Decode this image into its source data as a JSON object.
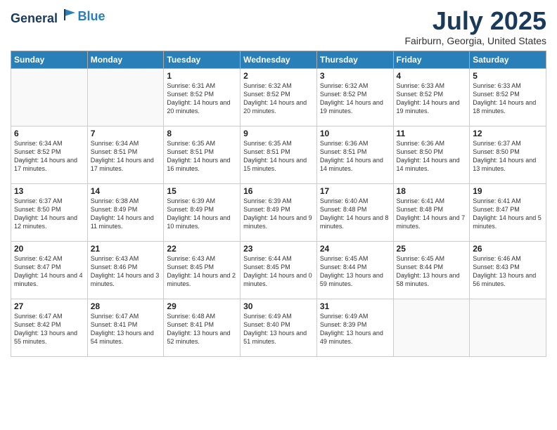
{
  "logo": {
    "general": "General",
    "blue": "Blue"
  },
  "title": "July 2025",
  "location": "Fairburn, Georgia, United States",
  "weekdays": [
    "Sunday",
    "Monday",
    "Tuesday",
    "Wednesday",
    "Thursday",
    "Friday",
    "Saturday"
  ],
  "weeks": [
    [
      {
        "day": "",
        "info": ""
      },
      {
        "day": "",
        "info": ""
      },
      {
        "day": "1",
        "info": "Sunrise: 6:31 AM\nSunset: 8:52 PM\nDaylight: 14 hours and 20 minutes."
      },
      {
        "day": "2",
        "info": "Sunrise: 6:32 AM\nSunset: 8:52 PM\nDaylight: 14 hours and 20 minutes."
      },
      {
        "day": "3",
        "info": "Sunrise: 6:32 AM\nSunset: 8:52 PM\nDaylight: 14 hours and 19 minutes."
      },
      {
        "day": "4",
        "info": "Sunrise: 6:33 AM\nSunset: 8:52 PM\nDaylight: 14 hours and 19 minutes."
      },
      {
        "day": "5",
        "info": "Sunrise: 6:33 AM\nSunset: 8:52 PM\nDaylight: 14 hours and 18 minutes."
      }
    ],
    [
      {
        "day": "6",
        "info": "Sunrise: 6:34 AM\nSunset: 8:52 PM\nDaylight: 14 hours and 17 minutes."
      },
      {
        "day": "7",
        "info": "Sunrise: 6:34 AM\nSunset: 8:51 PM\nDaylight: 14 hours and 17 minutes."
      },
      {
        "day": "8",
        "info": "Sunrise: 6:35 AM\nSunset: 8:51 PM\nDaylight: 14 hours and 16 minutes."
      },
      {
        "day": "9",
        "info": "Sunrise: 6:35 AM\nSunset: 8:51 PM\nDaylight: 14 hours and 15 minutes."
      },
      {
        "day": "10",
        "info": "Sunrise: 6:36 AM\nSunset: 8:51 PM\nDaylight: 14 hours and 14 minutes."
      },
      {
        "day": "11",
        "info": "Sunrise: 6:36 AM\nSunset: 8:50 PM\nDaylight: 14 hours and 14 minutes."
      },
      {
        "day": "12",
        "info": "Sunrise: 6:37 AM\nSunset: 8:50 PM\nDaylight: 14 hours and 13 minutes."
      }
    ],
    [
      {
        "day": "13",
        "info": "Sunrise: 6:37 AM\nSunset: 8:50 PM\nDaylight: 14 hours and 12 minutes."
      },
      {
        "day": "14",
        "info": "Sunrise: 6:38 AM\nSunset: 8:49 PM\nDaylight: 14 hours and 11 minutes."
      },
      {
        "day": "15",
        "info": "Sunrise: 6:39 AM\nSunset: 8:49 PM\nDaylight: 14 hours and 10 minutes."
      },
      {
        "day": "16",
        "info": "Sunrise: 6:39 AM\nSunset: 8:49 PM\nDaylight: 14 hours and 9 minutes."
      },
      {
        "day": "17",
        "info": "Sunrise: 6:40 AM\nSunset: 8:48 PM\nDaylight: 14 hours and 8 minutes."
      },
      {
        "day": "18",
        "info": "Sunrise: 6:41 AM\nSunset: 8:48 PM\nDaylight: 14 hours and 7 minutes."
      },
      {
        "day": "19",
        "info": "Sunrise: 6:41 AM\nSunset: 8:47 PM\nDaylight: 14 hours and 5 minutes."
      }
    ],
    [
      {
        "day": "20",
        "info": "Sunrise: 6:42 AM\nSunset: 8:47 PM\nDaylight: 14 hours and 4 minutes."
      },
      {
        "day": "21",
        "info": "Sunrise: 6:43 AM\nSunset: 8:46 PM\nDaylight: 14 hours and 3 minutes."
      },
      {
        "day": "22",
        "info": "Sunrise: 6:43 AM\nSunset: 8:45 PM\nDaylight: 14 hours and 2 minutes."
      },
      {
        "day": "23",
        "info": "Sunrise: 6:44 AM\nSunset: 8:45 PM\nDaylight: 14 hours and 0 minutes."
      },
      {
        "day": "24",
        "info": "Sunrise: 6:45 AM\nSunset: 8:44 PM\nDaylight: 13 hours and 59 minutes."
      },
      {
        "day": "25",
        "info": "Sunrise: 6:45 AM\nSunset: 8:44 PM\nDaylight: 13 hours and 58 minutes."
      },
      {
        "day": "26",
        "info": "Sunrise: 6:46 AM\nSunset: 8:43 PM\nDaylight: 13 hours and 56 minutes."
      }
    ],
    [
      {
        "day": "27",
        "info": "Sunrise: 6:47 AM\nSunset: 8:42 PM\nDaylight: 13 hours and 55 minutes."
      },
      {
        "day": "28",
        "info": "Sunrise: 6:47 AM\nSunset: 8:41 PM\nDaylight: 13 hours and 54 minutes."
      },
      {
        "day": "29",
        "info": "Sunrise: 6:48 AM\nSunset: 8:41 PM\nDaylight: 13 hours and 52 minutes."
      },
      {
        "day": "30",
        "info": "Sunrise: 6:49 AM\nSunset: 8:40 PM\nDaylight: 13 hours and 51 minutes."
      },
      {
        "day": "31",
        "info": "Sunrise: 6:49 AM\nSunset: 8:39 PM\nDaylight: 13 hours and 49 minutes."
      },
      {
        "day": "",
        "info": ""
      },
      {
        "day": "",
        "info": ""
      }
    ]
  ]
}
